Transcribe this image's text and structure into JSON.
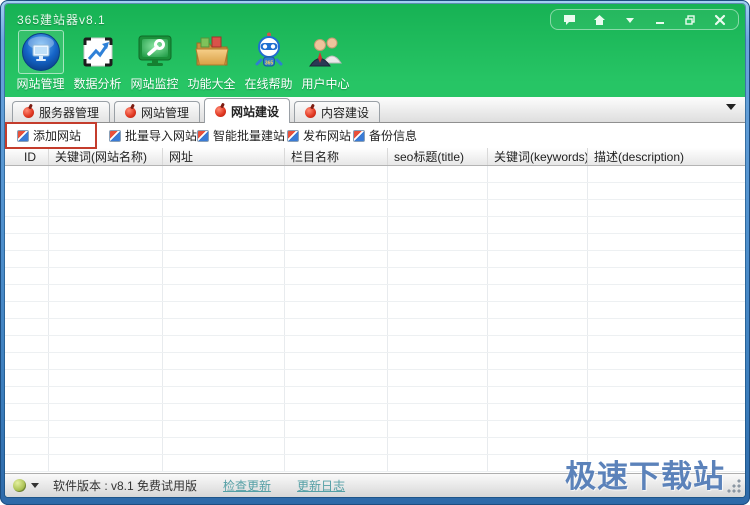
{
  "window": {
    "title": "365建站器v8.1",
    "controls": [
      {
        "name": "feedback"
      },
      {
        "name": "home"
      },
      {
        "name": "menu"
      },
      {
        "name": "minimize"
      },
      {
        "name": "restore"
      },
      {
        "name": "close"
      }
    ]
  },
  "toolbar": {
    "items": [
      {
        "label": "网站管理",
        "icon": "site-manage-monitor-icon",
        "selected": true
      },
      {
        "label": "数据分析",
        "icon": "data-analysis-chart-icon",
        "selected": false
      },
      {
        "label": "网站监控",
        "icon": "site-monitor-wrench-icon",
        "selected": false
      },
      {
        "label": "功能大全",
        "icon": "features-folder-icon",
        "selected": false
      },
      {
        "label": "在线帮助",
        "icon": "online-help-robot-icon",
        "selected": false
      },
      {
        "label": "用户中心",
        "icon": "user-center-people-icon",
        "selected": false
      }
    ]
  },
  "tabs": {
    "active_index": 2,
    "items": [
      {
        "label": "服务器管理"
      },
      {
        "label": "网站管理"
      },
      {
        "label": "网站建设"
      },
      {
        "label": "内容建设"
      }
    ]
  },
  "actions": {
    "items": [
      {
        "label": "添加网站",
        "highlighted": true
      },
      {
        "label": "批量导入网站",
        "highlighted": false
      },
      {
        "label": "智能批量建站",
        "highlighted": false
      },
      {
        "label": "发布网站",
        "highlighted": false
      },
      {
        "label": "备份信息",
        "highlighted": false
      }
    ]
  },
  "table": {
    "columns": [
      {
        "label": "ID"
      },
      {
        "label": "关键词(网站名称)"
      },
      {
        "label": "网址"
      },
      {
        "label": "栏目名称"
      },
      {
        "label": "seo标题(title)"
      },
      {
        "label": "关键词(keywords)"
      },
      {
        "label": "描述(description)"
      }
    ],
    "visible_empty_rows": 18
  },
  "statusbar": {
    "version_text": "软件版本 : v8.1  免费试用版",
    "links": [
      {
        "label": "检查更新"
      },
      {
        "label": "更新日志"
      }
    ]
  },
  "watermark": {
    "text": "极速下载站"
  },
  "colors": {
    "titlebar_green": "#27c565",
    "frame_blue": "#4f90cd",
    "link_teal": "#55a0a6",
    "highlight_red": "#c43c2c",
    "watermark_blue": "#5b82ba"
  }
}
